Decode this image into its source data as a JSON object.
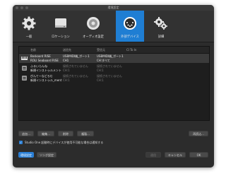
{
  "window": {
    "title": "環境設定"
  },
  "toolbar": {
    "items": [
      {
        "label": "一般",
        "icon": "gear-icon"
      },
      {
        "label": "ロケーション",
        "icon": "drive-icon"
      },
      {
        "label": "オーディオ設定",
        "icon": "speaker-icon"
      },
      {
        "label": "外部デバイス",
        "icon": "midi-plug-icon",
        "active": true
      },
      {
        "label": "詳細",
        "icon": "gears-icon"
      }
    ]
  },
  "table": {
    "headers": {
      "name": "名前",
      "input": "送信先",
      "output": "受信元",
      "ci": "CI To In"
    },
    "rows": [
      {
        "line1": {
          "name": "Boskoord RISE",
          "input": "USBMIDI端_ポート1",
          "output": "USBMIDI端_ポート1"
        },
        "line2": {
          "name": "ROLI Seaboard RISE",
          "input": "CH1",
          "output": "CH:すべて"
        },
        "selected": true
      },
      {
        "line1": {
          "name": "ふるいらんね",
          "input": "接続されていません",
          "output": "接続されていません"
        },
        "line2": {
          "name": "新規インストゥルメント",
          "input": "CH:1",
          "output": "CH:1"
        },
        "selected": false
      },
      {
        "line1": {
          "name": "ぴんてーなどろむ",
          "input": "接続されていません",
          "output": "接続されていません"
        },
        "line2": {
          "name": "新規インストゥル_ment",
          "input": "CH:1",
          "output": "CH:1"
        },
        "selected": false
      }
    ]
  },
  "buttons": {
    "add": "追加...",
    "edit": "編集...",
    "delete": "削除",
    "duplicate": "複製...",
    "rescan": "再読込..."
  },
  "checkbox": {
    "label": "Studio One 起動時にデバイスが使用不可能な場合は通知する",
    "checked": true
  },
  "footer": {
    "preferences": "環境設定",
    "song_settings": "ソング設定",
    "apply": "適用",
    "cancel": "キャンセル",
    "ok": "OK"
  },
  "colors": {
    "accent": "#1f7ed3",
    "window_bg": "#2c2c2c",
    "list_bg": "#1e1e1e"
  }
}
